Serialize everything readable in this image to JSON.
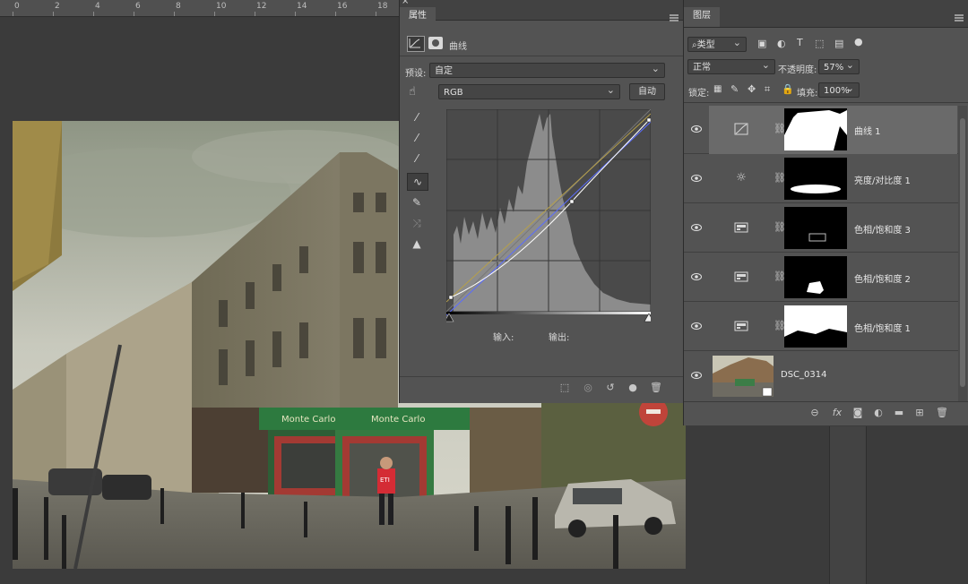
{
  "ruler": {
    "marks": [
      "0",
      "2",
      "4",
      "6",
      "8",
      "10",
      "12",
      "14",
      "16",
      "18"
    ]
  },
  "properties": {
    "tab": "属性",
    "header_title": "曲线",
    "preset_label": "预设:",
    "preset_value": "自定",
    "channel_value": "RGB",
    "auto_button": "自动",
    "input_label": "输入:",
    "output_label": "输出:"
  },
  "layers_panel": {
    "tab": "图层",
    "filter_value": "类型",
    "blend_mode": "正常",
    "opacity_label": "不透明度:",
    "opacity_value": "57%",
    "lock_label": "锁定:",
    "fill_label": "填充:",
    "fill_value": "100%",
    "layers": [
      {
        "name": "曲线 1",
        "type": "curves-icon",
        "selected": true
      },
      {
        "name": "亮度/对比度 1",
        "type": "sun-icon",
        "selected": false
      },
      {
        "name": "色相/饱和度 3",
        "type": "hue-saturation-icon",
        "selected": false
      },
      {
        "name": "色相/饱和度 2",
        "type": "hue-saturation-icon",
        "selected": false
      },
      {
        "name": "色相/饱和度 1",
        "type": "hue-saturation-icon",
        "selected": false
      },
      {
        "name": "DSC_0314",
        "type": "photo",
        "selected": false
      }
    ]
  },
  "photo": {
    "signs": [
      "Monte Carlo",
      "Monte Carlo",
      "ETI"
    ]
  },
  "colors": {
    "panel": "#535353",
    "tabbar": "#424242",
    "selected_layer": "#6a6a6a",
    "curve_white": "#ffffff",
    "curve_blue": "#5a6cff",
    "curve_olive": "#b6a04a"
  }
}
